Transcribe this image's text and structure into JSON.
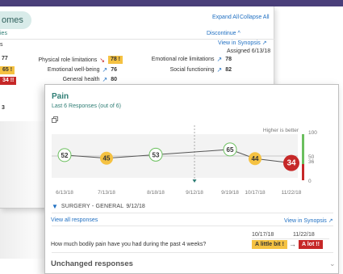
{
  "background": {
    "tab_label": "omes",
    "expand_all": "Expand All",
    "collapse_all": "Collapse All",
    "left_partial_label": "ies",
    "left_partial_label2": "s",
    "discontinue": "Discontinue",
    "discontinue_icon": "chevron-up",
    "view_in_synopsis": "View in Synopsis",
    "assigned": "Assigned 6/13/18",
    "left_values": [
      "77",
      "65",
      "34"
    ],
    "left_chip_65": "65 !",
    "left_chip_34": "34 !!",
    "left_value_bottom": "3",
    "rows": [
      {
        "label": "Physical role limitations",
        "trend": "down",
        "value": "78 !",
        "chip": "yellow"
      },
      {
        "label": "Emotional well-being",
        "trend": "up",
        "value": "76",
        "chip": ""
      },
      {
        "label": "General health",
        "trend": "up",
        "value": "80",
        "chip": ""
      },
      {
        "label": "Emotional role limitations",
        "trend": "up",
        "value": "78",
        "chip": ""
      },
      {
        "label": "Social functioning",
        "trend": "up",
        "value": "82",
        "chip": ""
      }
    ]
  },
  "card": {
    "title": "Pain",
    "subtitle": "Last 6 Responses (out of 6)",
    "filter_label": "SURGERY - GENERAL",
    "filter_date": "9/12/18",
    "view_all": "View all responses",
    "view_in_synopsis": "View in Synopsis",
    "prev_date": "10/17/18",
    "curr_date": "11/22/18",
    "question": "How much bodily pain have you had during the past 4 weeks?",
    "prev_answer": "A little bit !",
    "curr_answer": "A lot !!",
    "unchanged_title": "Unchanged responses"
  },
  "chart_data": {
    "type": "line",
    "x": [
      "6/13/18",
      "7/13/18",
      "8/18/18",
      "9/19/18",
      "10/17/18",
      "11/22/18"
    ],
    "values": [
      52,
      45,
      53,
      65,
      44,
      34
    ],
    "x_ticks": [
      "6/13/18",
      "7/13/18",
      "8/18/18",
      "9/12/18",
      "9/19/18",
      "10/17/18",
      "11/22/18"
    ],
    "marker_date": "9/12/18",
    "y_ticks_right": [
      "100",
      "50",
      "36",
      "0"
    ],
    "better_label": "Higher is better",
    "ylim": [
      0,
      100
    ],
    "point_colors": [
      "white",
      "yellow",
      "white",
      "white",
      "yellow",
      "red"
    ],
    "colors": {
      "white": "#ffffff",
      "yellow": "#f5c242",
      "red": "#c62828",
      "green_outline": "#6bbf5e"
    }
  }
}
